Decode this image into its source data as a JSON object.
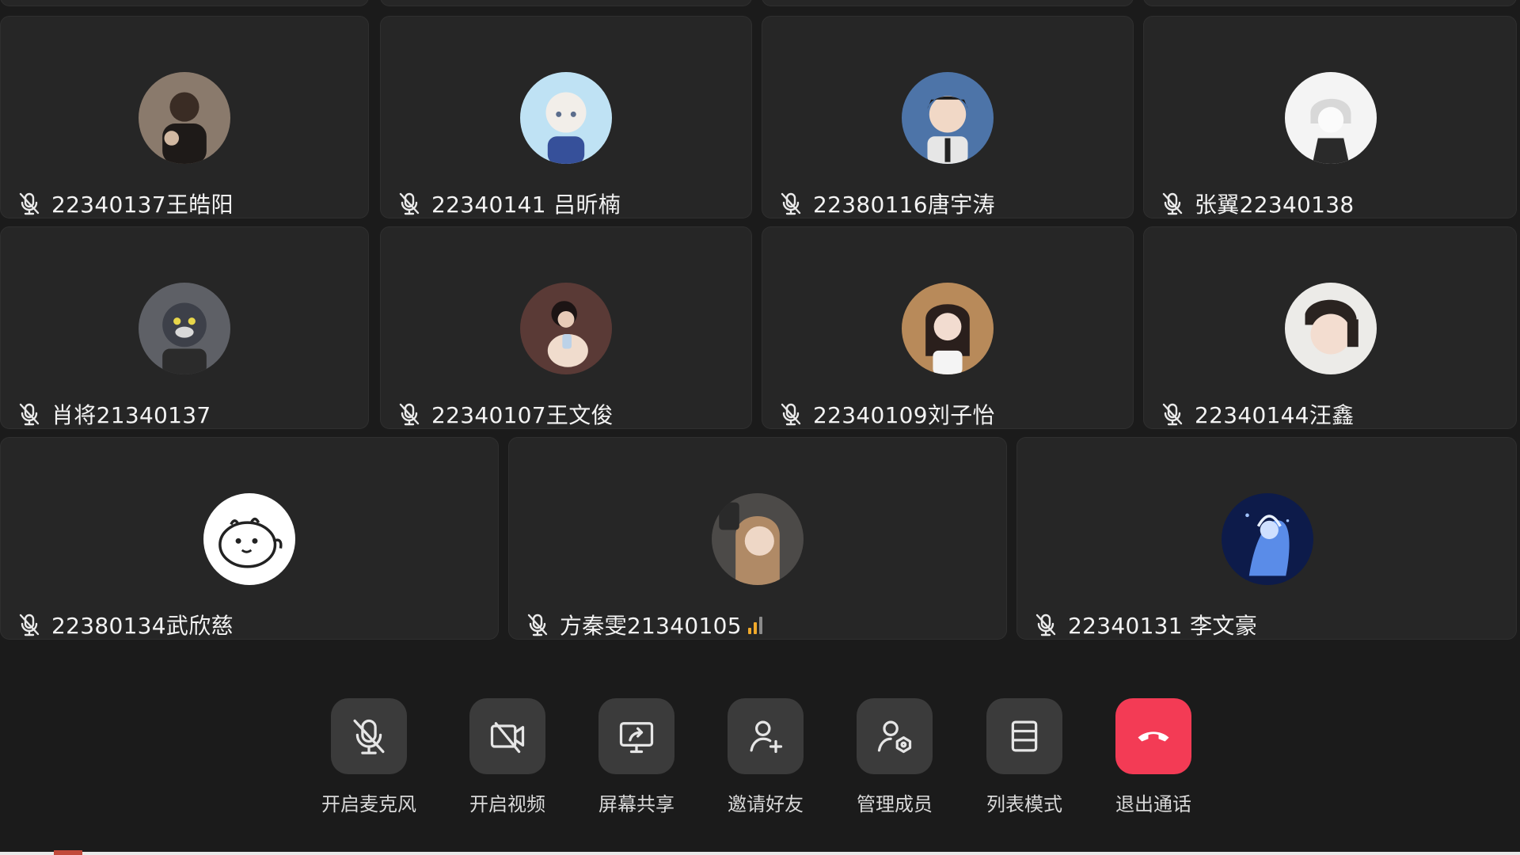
{
  "participants": [
    {
      "name": "22340137王皓阳",
      "mic": "muted"
    },
    {
      "name": "22340141 吕昕楠",
      "mic": "muted"
    },
    {
      "name": "22380116唐宇涛",
      "mic": "muted"
    },
    {
      "name": "张翼22340138",
      "mic": "muted"
    },
    {
      "name": "肖将21340137",
      "mic": "muted"
    },
    {
      "name": "22340107王文俊",
      "mic": "muted"
    },
    {
      "name": "22340109刘子怡",
      "mic": "muted"
    },
    {
      "name": "22340144汪鑫",
      "mic": "muted"
    },
    {
      "name": "22380134武欣慈",
      "mic": "muted"
    },
    {
      "name": "方秦雯21340105",
      "mic": "muted",
      "signal_icon": "signal-bars-icon"
    },
    {
      "name": "22340131 李文豪",
      "mic": "muted"
    }
  ],
  "controls": {
    "mic_label": "开启麦克风",
    "video_label": "开启视频",
    "share_label": "屏幕共享",
    "invite_label": "邀请好友",
    "manage_label": "管理成员",
    "list_label": "列表模式",
    "exit_label": "退出通话"
  },
  "colors": {
    "background": "#1b1b1b",
    "tile": "#262626",
    "button": "#3b3b3b",
    "exit_button": "#f33b55",
    "signal": "#f0a92b"
  }
}
